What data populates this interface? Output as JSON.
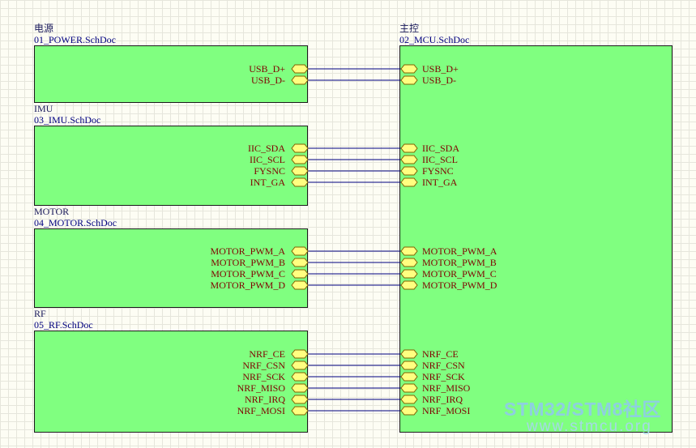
{
  "sheets": {
    "power": {
      "name": "电源",
      "file": "01_POWER.SchDoc",
      "ports": [
        "USB_D+",
        "USB_D-"
      ]
    },
    "imu": {
      "name": "IMU",
      "file": "03_IMU.SchDoc",
      "ports": [
        "IIC_SDA",
        "IIC_SCL",
        "FYSNC",
        "INT_GA"
      ]
    },
    "motor": {
      "name": "MOTOR",
      "file": "04_MOTOR.SchDoc",
      "ports": [
        "MOTOR_PWM_A",
        "MOTOR_PWM_B",
        "MOTOR_PWM_C",
        "MOTOR_PWM_D"
      ]
    },
    "rf": {
      "name": "RF",
      "file": "05_RF.SchDoc",
      "ports": [
        "NRF_CE",
        "NRF_CSN",
        "NRF_SCK",
        "NRF_MISO",
        "NRF_IRQ",
        "NRF_MOSI"
      ]
    },
    "mcu": {
      "name": "主控",
      "file": "02_MCU.SchDoc",
      "ports": [
        "USB_D+",
        "USB_D-",
        "IIC_SDA",
        "IIC_SCL",
        "FYSNC",
        "INT_GA",
        "MOTOR_PWM_A",
        "MOTOR_PWM_B",
        "MOTOR_PWM_C",
        "MOTOR_PWM_D",
        "NRF_CE",
        "NRF_CSN",
        "NRF_SCK",
        "NRF_MISO",
        "NRF_IRQ",
        "NRF_MOSI"
      ]
    }
  },
  "colors": {
    "block_fill": "#80ff80",
    "wire": "#000080",
    "port_fill": "#ffff80",
    "port_text": "#800000",
    "label": "#000080"
  },
  "watermark": {
    "line1": "STM32/STM8社区",
    "line2": "www.stmcu.org"
  }
}
